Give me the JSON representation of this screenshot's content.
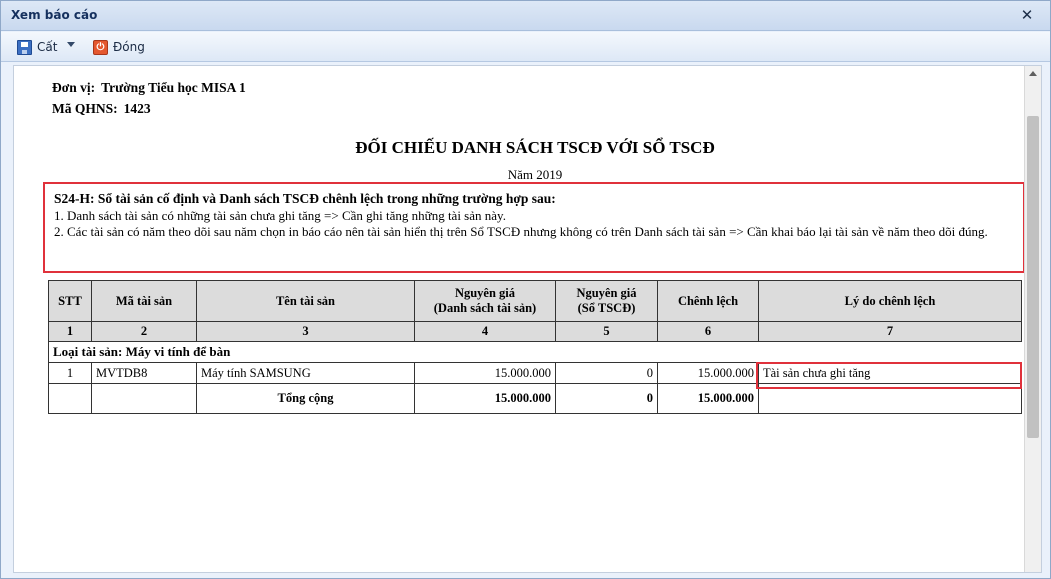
{
  "window": {
    "title": "Xem báo cáo",
    "close_glyph": "✕"
  },
  "toolbar": {
    "save_label": "Cất",
    "close_label": "Đóng",
    "save_icon": "save-icon",
    "close_icon": "power-icon"
  },
  "report": {
    "unit_label": "Đơn vị:",
    "unit_value": "Trường Tiểu học MISA 1",
    "code_label": "Mã QHNS:",
    "code_value": "1423",
    "title": "ĐỐI CHIẾU DANH SÁCH TSCĐ VỚI SỔ TSCĐ",
    "year": "Năm 2019",
    "note": {
      "heading": "S24-H: Sổ tài sản cố định và Danh sách TSCĐ chênh lệch trong những trường hợp sau:",
      "line1": "1. Danh sách tài sản có những tài sản chưa ghi tăng => Cần ghi tăng những tài sản này.",
      "line2": "2. Các tài sản có năm theo dõi sau năm chọn in báo cáo nên tài sản hiển thị trên Sổ TSCĐ nhưng không có trên Danh sách tài sản => Cần khai báo lại tài sản về năm theo dõi đúng."
    },
    "table": {
      "headers": {
        "stt": "STT",
        "code": "Mã tài sản",
        "name": "Tên tài sản",
        "cost_list_1": "Nguyên giá",
        "cost_list_2": "(Danh sách tài sản)",
        "cost_book_1": "Nguyên giá",
        "cost_book_2": "(Sổ TSCĐ)",
        "diff": "Chênh lệch",
        "reason": "Lý do chênh lệch"
      },
      "index_row": [
        "1",
        "2",
        "3",
        "4",
        "5",
        "6",
        "7"
      ],
      "group_label": "Loại tài sản: Máy vi tính để bàn",
      "rows": [
        {
          "stt": "1",
          "code": "MVTDB8",
          "name": "Máy tính SAMSUNG",
          "cost_list": "15.000.000",
          "cost_book": "0",
          "diff": "15.000.000",
          "reason": "Tài sản chưa ghi tăng"
        }
      ],
      "total": {
        "label": "Tổng cộng",
        "cost_list": "15.000.000",
        "cost_book": "0",
        "diff": "15.000.000"
      }
    }
  }
}
